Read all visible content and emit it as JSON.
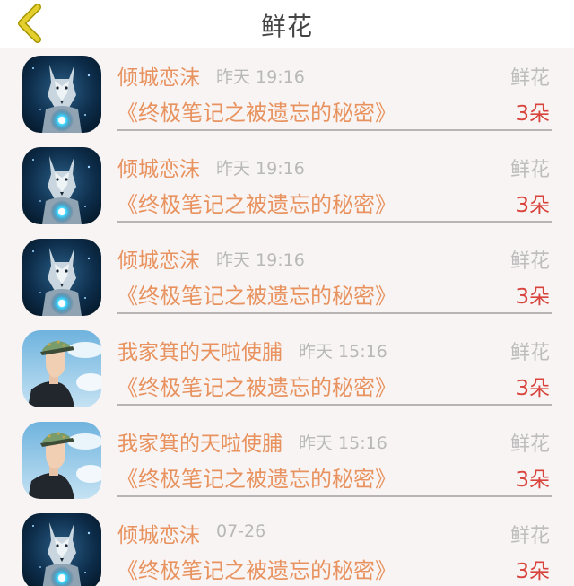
{
  "header": {
    "title": "鲜花",
    "back_icon": "chevron-left-icon",
    "back_color": "#e4cf2e"
  },
  "records": [
    {
      "avatar": "wolf",
      "name": "倾城恋沫",
      "time": "昨天 19:16",
      "gift_type": "鲜花",
      "book": "《终极笔记之被遗忘的秘密》",
      "count": "3朵"
    },
    {
      "avatar": "wolf",
      "name": "倾城恋沫",
      "time": "昨天 19:16",
      "gift_type": "鲜花",
      "book": "《终极笔记之被遗忘的秘密》",
      "count": "3朵"
    },
    {
      "avatar": "wolf",
      "name": "倾城恋沫",
      "time": "昨天 19:16",
      "gift_type": "鲜花",
      "book": "《终极笔记之被遗忘的秘密》",
      "count": "3朵"
    },
    {
      "avatar": "man",
      "name": "我家箕的天啦使脯",
      "time": "昨天 15:16",
      "gift_type": "鲜花",
      "book": "《终极笔记之被遗忘的秘密》",
      "count": "3朵"
    },
    {
      "avatar": "man",
      "name": "我家箕的天啦使脯",
      "time": "昨天 15:16",
      "gift_type": "鲜花",
      "book": "《终极笔记之被遗忘的秘密》",
      "count": "3朵"
    },
    {
      "avatar": "wolf",
      "name": "倾城恋沫",
      "time": "07-26",
      "gift_type": "鲜花",
      "book": "《终极笔记之被遗忘的秘密》",
      "count": "3朵"
    }
  ],
  "colors": {
    "name": "#e8935f",
    "time": "#b8b8b8",
    "count": "#d8443c",
    "list_bg": "#f8f4f4"
  }
}
